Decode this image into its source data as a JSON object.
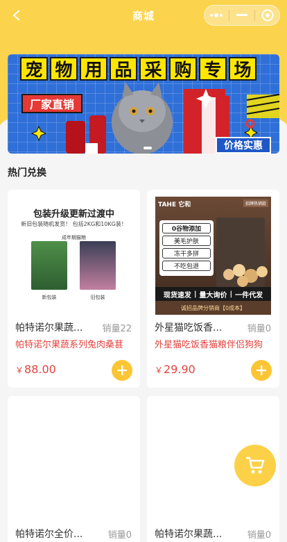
{
  "nav": {
    "title": "商城"
  },
  "banner": {
    "title_chars": [
      "宠",
      "物",
      "用",
      "品",
      "采",
      "购",
      "专",
      "场"
    ],
    "tag": "厂家直销",
    "price_tag": "价格实惠"
  },
  "section": {
    "title": "热门兑换"
  },
  "products": [
    {
      "name": "帕特诺尔果蔬...",
      "sales": "销量22",
      "desc": "帕特诺尔果蔬系列兔肉桑葚",
      "yen": "￥",
      "price": "88.00",
      "image": {
        "title": "包装升级更新过渡中",
        "subtitle": "新旧包装随机发货！ 包括2KG和10KG装！",
        "label": "成年期猫粮",
        "old_caption": "新包装",
        "new_caption": "旧包装"
      }
    },
    {
      "name": "外星猫吃饭香...",
      "sales": "销量0",
      "desc": "外星猫吃饭香猫粮伴侣狗狗",
      "yen": "￥",
      "price": "29.90",
      "image": {
        "brand": "TAHE 它和",
        "badge": "招牌热销款",
        "pills": [
          "0谷物添加",
          "美毛护肤",
          "冻干多拼",
          "不吃包退"
        ],
        "strip": [
          "现货速发",
          "量大询价",
          "一件代发"
        ],
        "foot": "诚招品牌分销商【0成本】"
      }
    },
    {
      "name": "帕特诺尔全价...",
      "sales": "销量0"
    },
    {
      "name": "帕特诺尔果蔬...",
      "sales": "销量0"
    }
  ],
  "colors": {
    "accent_yellow": "#fcd34d",
    "price_red": "#e2443f",
    "add_button": "#fcc534"
  },
  "icons": {
    "back": "back-arrow-icon",
    "more": "more-dots-icon",
    "minimize": "minimize-icon",
    "close": "target-circle-icon",
    "add": "plus-icon",
    "cart": "cart-icon"
  }
}
